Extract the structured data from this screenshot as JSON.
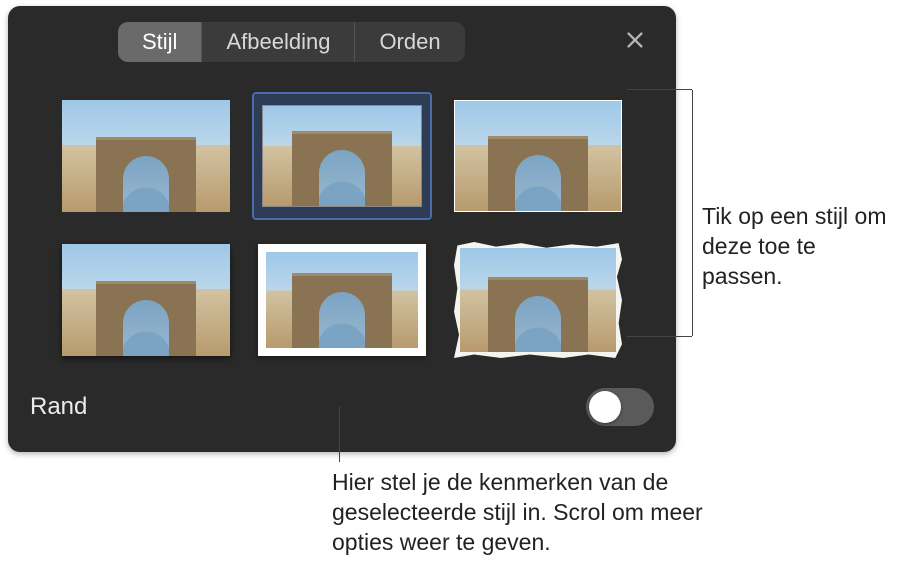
{
  "tabs": {
    "stijl": "Stijl",
    "afbeelding": "Afbeelding",
    "orden": "Orden"
  },
  "styles": [
    {
      "name": "style-plain"
    },
    {
      "name": "style-framed-selected"
    },
    {
      "name": "style-outline"
    },
    {
      "name": "style-shadow"
    },
    {
      "name": "style-mat"
    },
    {
      "name": "style-torn-paper"
    }
  ],
  "footer": {
    "rand_label": "Rand"
  },
  "callouts": {
    "c1": "Tik op een stijl om deze toe te passen.",
    "c2": "Hier stel je de kenmerken van de geselecteerde stijl in. Scrol om meer opties weer te geven."
  }
}
